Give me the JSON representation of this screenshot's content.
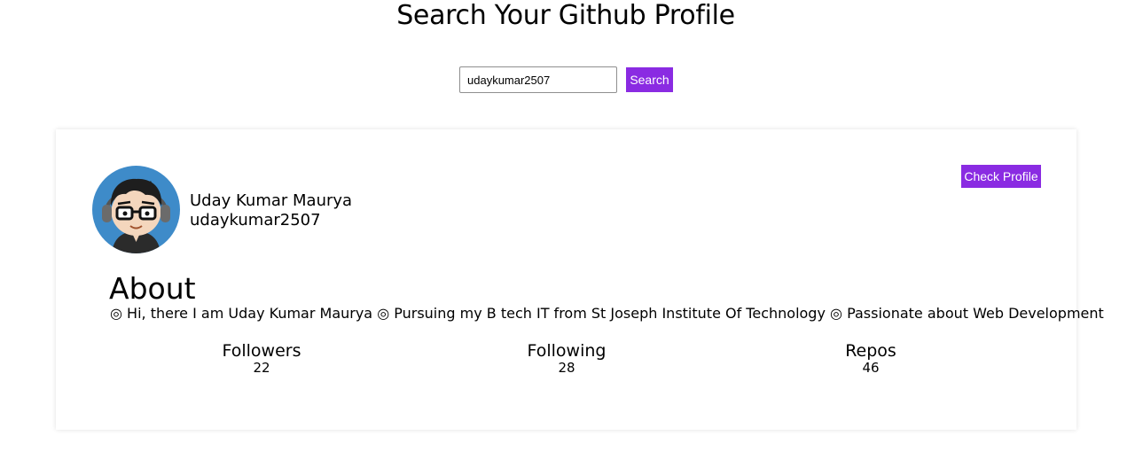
{
  "header": {
    "title": "Search Your Github Profile"
  },
  "search": {
    "value": "udaykumar2507",
    "button_label": "Search"
  },
  "profile": {
    "name": "Uday Kumar Maurya",
    "username": "udaykumar2507",
    "check_profile_label": "Check Profile",
    "about_heading": "About",
    "about_text": "◎ Hi, there I am Uday Kumar Maurya ◎ Pursuing my B tech IT from St Joseph Institute Of Technology ◎ Passionate about Web Development",
    "stats": [
      {
        "label": "Followers",
        "value": "22"
      },
      {
        "label": "Following",
        "value": "28"
      },
      {
        "label": "Repos",
        "value": "46"
      }
    ]
  },
  "colors": {
    "accent": "#8a2be2",
    "avatar_bg": "#3e8bc9"
  }
}
